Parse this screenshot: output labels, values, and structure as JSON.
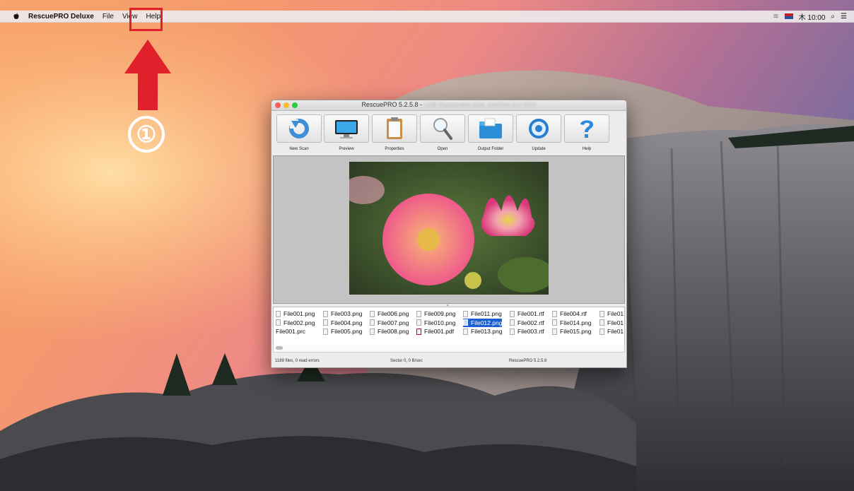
{
  "menubar": {
    "app_name": "RescuePRO Deluxe",
    "menus": [
      "File",
      "View",
      "Help"
    ],
    "clock": "木 10:00",
    "search_glyph": "⌕",
    "list_glyph": "☰",
    "wifi_glyph": "≋"
  },
  "annotation": {
    "step_label": "①",
    "highlight_color": "#e0202a"
  },
  "window": {
    "title_visible": "RescuePRO 5.2.5.8 - ",
    "title_blurred": "USB Removable Disk SanDisk Ext SSD",
    "toolbar": [
      {
        "label": "New Scan",
        "icon": "refresh-icon"
      },
      {
        "label": "Preview",
        "icon": "monitor-icon"
      },
      {
        "label": "Properties",
        "icon": "clipboard-icon"
      },
      {
        "label": "Open",
        "icon": "magnifier-icon"
      },
      {
        "label": "Output Folder",
        "icon": "folder-icon"
      },
      {
        "label": "Update",
        "icon": "update-icon"
      },
      {
        "label": "Help",
        "icon": "question-icon"
      }
    ],
    "files": {
      "columns": [
        [
          "File001.png",
          "File002.png",
          "File001.prc"
        ],
        [
          "File003.png",
          "File004.png",
          "File005.png"
        ],
        [
          "File006.png",
          "File007.png",
          "File008.png"
        ],
        [
          "File009.png",
          "File010.png",
          "File001.pdf"
        ],
        [
          "File011.png",
          "File012.png",
          "File013.png"
        ],
        [
          "File001.rtf",
          "File002.rtf",
          "File003.rtf"
        ],
        [
          "File004.rtf",
          "File014.png",
          "File015.png"
        ],
        [
          "File01",
          "File01",
          "File01"
        ]
      ],
      "selected": "File012.png"
    },
    "status": {
      "files": "1189 files, 0 read errors",
      "sector": "Sector 0, 0 B/sec",
      "version": "RescuePRO 5.2.5.8"
    }
  },
  "colors": {
    "accent_selection": "#1a5fd1",
    "traffic_close": "#fc5f57",
    "traffic_min": "#fdbb2e",
    "traffic_zoom": "#29c940"
  }
}
